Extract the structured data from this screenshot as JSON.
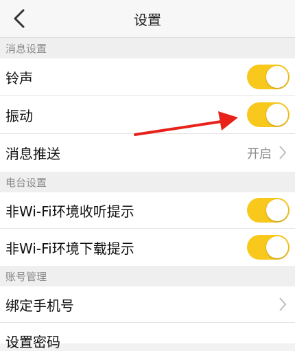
{
  "header": {
    "title": "设置",
    "back_icon": "chevron-left-icon"
  },
  "sections": {
    "message": {
      "title": "消息设置"
    },
    "radio": {
      "title": "电台设置"
    },
    "account": {
      "title": "账号管理"
    }
  },
  "rows": {
    "ringtone": {
      "label": "铃声",
      "toggle_on": true
    },
    "vibrate": {
      "label": "振动",
      "toggle_on": true
    },
    "push": {
      "label": "消息推送",
      "value": "开启"
    },
    "wifi_listen": {
      "label": "非Wi-Fi环境收听提示",
      "toggle_on": true
    },
    "wifi_download": {
      "label": "非Wi-Fi环境下载提示",
      "toggle_on": true
    },
    "bind_phone": {
      "label": "绑定手机号"
    },
    "set_password": {
      "label": "设置密码"
    }
  },
  "colors": {
    "accent": "#f8c81c",
    "annotation_arrow": "#e8221b"
  }
}
